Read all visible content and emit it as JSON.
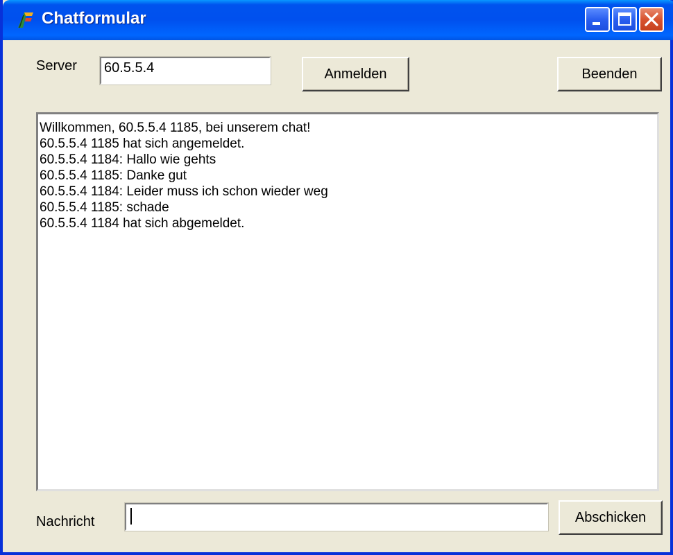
{
  "window": {
    "title": "Chatformular"
  },
  "icons": {
    "app": "app-icon",
    "minimize": "minimize-icon",
    "maximize": "maximize-icon",
    "close": "close-icon"
  },
  "server": {
    "label": "Server",
    "value": "60.5.5.4"
  },
  "buttons": {
    "login": "Anmelden",
    "quit": "Beenden",
    "send": "Abschicken"
  },
  "chat": {
    "lines": [
      "Willkommen, 60.5.5.4 1185, bei unserem chat!",
      "60.5.5.4 1185 hat sich angemeldet.",
      "60.5.5.4 1184: Hallo wie gehts",
      "60.5.5.4 1185: Danke gut",
      "60.5.5.4 1184: Leider muss ich schon wieder weg",
      "60.5.5.4 1185: schade",
      "60.5.5.4 1184 hat sich abgemeldet."
    ]
  },
  "message": {
    "label": "Nachricht",
    "value": ""
  },
  "colors": {
    "titlebar": "#0054e3",
    "window_face": "#ece9d8",
    "close_button": "#d8532f"
  }
}
